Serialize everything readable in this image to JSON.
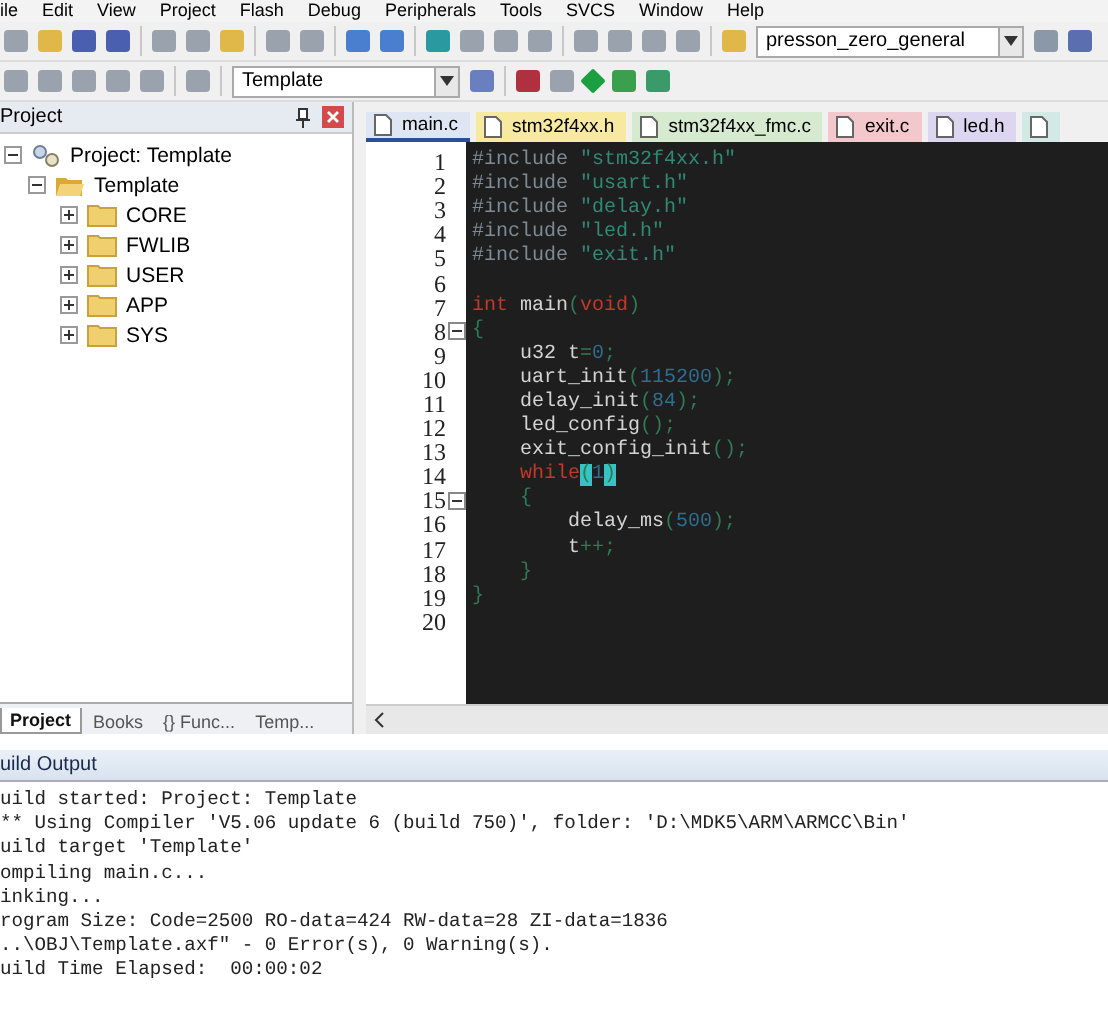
{
  "menu": [
    "ile",
    "Edit",
    "View",
    "Project",
    "Flash",
    "Debug",
    "Peripherals",
    "Tools",
    "SVCS",
    "Window",
    "Help"
  ],
  "toolbar": {
    "target_dropdown": "presson_zero_general",
    "project_dropdown": "Template"
  },
  "project_panel": {
    "title": "Project",
    "tree": [
      {
        "label": "Project: Template",
        "kind": "project",
        "expanded": true,
        "children": [
          {
            "label": "Template",
            "kind": "group",
            "expanded": true,
            "children": [
              {
                "label": "CORE",
                "kind": "folder",
                "expanded": false
              },
              {
                "label": "FWLIB",
                "kind": "folder",
                "expanded": false
              },
              {
                "label": "USER",
                "kind": "folder",
                "expanded": false
              },
              {
                "label": "APP",
                "kind": "folder",
                "expanded": false
              },
              {
                "label": "SYS",
                "kind": "folder",
                "expanded": false
              }
            ]
          }
        ]
      }
    ],
    "tabs": [
      {
        "label": "Project",
        "selected": true
      },
      {
        "label": "Books",
        "selected": false
      },
      {
        "label": "{} Func...",
        "selected": false
      },
      {
        "label": "Temp...",
        "selected": false
      }
    ]
  },
  "editor": {
    "tabs": [
      {
        "label": "main.c",
        "selected": true,
        "color": "#dfe6f3"
      },
      {
        "label": "stm32f4xx.h",
        "selected": false,
        "color": "#f7e9a0"
      },
      {
        "label": "stm32f4xx_fmc.c",
        "selected": false,
        "color": "#d6ead0"
      },
      {
        "label": "exit.c",
        "selected": false,
        "color": "#f3c8cc"
      },
      {
        "label": "led.h",
        "selected": false,
        "color": "#dcd6f0"
      },
      {
        "selected": false,
        "color": "#d3e9e6"
      }
    ],
    "lines": [
      {
        "n": "1",
        "fold": false,
        "segs": [
          {
            "t": "#include ",
            "kind": "pp"
          },
          {
            "t": "\"stm32f4xx.h\"",
            "kind": "str"
          }
        ]
      },
      {
        "n": "2",
        "fold": false,
        "segs": [
          {
            "t": "#include ",
            "kind": "pp"
          },
          {
            "t": "\"usart.h\"",
            "kind": "str"
          }
        ]
      },
      {
        "n": "3",
        "fold": false,
        "segs": [
          {
            "t": "#include ",
            "kind": "pp"
          },
          {
            "t": "\"delay.h\"",
            "kind": "str"
          }
        ]
      },
      {
        "n": "4",
        "fold": false,
        "segs": [
          {
            "t": "#include ",
            "kind": "pp"
          },
          {
            "t": "\"led.h\"",
            "kind": "str"
          }
        ]
      },
      {
        "n": "5",
        "fold": false,
        "segs": [
          {
            "t": "#include ",
            "kind": "pp"
          },
          {
            "t": "\"exit.h\"",
            "kind": "str"
          }
        ]
      },
      {
        "n": "6",
        "fold": false
      },
      {
        "n": "7",
        "fold": false,
        "segs": [
          {
            "t": "int",
            "kind": "kw"
          },
          {
            "t": " main",
            "kind": "id"
          },
          {
            "t": "(",
            "kind": "p"
          },
          {
            "t": "void",
            "kind": "kw"
          },
          {
            "t": ")",
            "kind": "p"
          }
        ]
      },
      {
        "n": "8",
        "fold": true,
        "segs": [
          {
            "t": "{",
            "kind": "p"
          }
        ]
      },
      {
        "n": "9",
        "fold": false,
        "segs": [
          {
            "t": "    u32 t",
            "kind": "id"
          },
          {
            "t": "=",
            "kind": "p"
          },
          {
            "t": "0",
            "kind": "num"
          },
          {
            "t": ";",
            "kind": "p"
          }
        ]
      },
      {
        "n": "10",
        "fold": false,
        "segs": [
          {
            "t": "    uart_init",
            "kind": "id"
          },
          {
            "t": "(",
            "kind": "p"
          },
          {
            "t": "115200",
            "kind": "num"
          },
          {
            "t": ");",
            "kind": "p"
          }
        ]
      },
      {
        "n": "11",
        "fold": false,
        "segs": [
          {
            "t": "    delay_init",
            "kind": "id"
          },
          {
            "t": "(",
            "kind": "p"
          },
          {
            "t": "84",
            "kind": "num"
          },
          {
            "t": ");",
            "kind": "p"
          }
        ]
      },
      {
        "n": "12",
        "fold": false,
        "segs": [
          {
            "t": "    led_config",
            "kind": "id"
          },
          {
            "t": "();",
            "kind": "p"
          }
        ]
      },
      {
        "n": "13",
        "fold": false,
        "segs": [
          {
            "t": "    exit_config_init",
            "kind": "id"
          },
          {
            "t": "();",
            "kind": "p"
          }
        ]
      },
      {
        "n": "14",
        "fold": false,
        "segs": [
          {
            "t": "    while",
            "kind": "kw"
          },
          {
            "t": "(",
            "kind": "match"
          },
          {
            "t": "1",
            "kind": "num"
          },
          {
            "t": ")",
            "kind": "match"
          }
        ]
      },
      {
        "n": "15",
        "fold": true,
        "segs": [
          {
            "t": "    {",
            "kind": "p"
          }
        ]
      },
      {
        "n": "16",
        "fold": false,
        "segs": [
          {
            "t": "        delay_ms",
            "kind": "id"
          },
          {
            "t": "(",
            "kind": "p"
          },
          {
            "t": "500",
            "kind": "num"
          },
          {
            "t": ");",
            "kind": "p"
          }
        ]
      },
      {
        "n": "17",
        "fold": false,
        "segs": [
          {
            "t": "        t",
            "kind": "id"
          },
          {
            "t": "++;",
            "kind": "p"
          }
        ]
      },
      {
        "n": "18",
        "fold": false,
        "segs": [
          {
            "t": "    }",
            "kind": "p"
          }
        ]
      },
      {
        "n": "19",
        "fold": false,
        "segs": [
          {
            "t": "}",
            "kind": "p"
          }
        ]
      },
      {
        "n": "20",
        "fold": false
      }
    ]
  },
  "build_output": {
    "title": "uild Output",
    "lines": [
      "uild started: Project: Template",
      "** Using Compiler 'V5.06 update 6 (build 750)', folder: 'D:\\MDK5\\ARM\\ARMCC\\Bin'",
      "uild target 'Template'",
      "ompiling main.c...",
      "inking...",
      "rogram Size: Code=2500 RO-data=424 RW-data=28 ZI-data=1836",
      "..\\OBJ\\Template.axf\" - 0 Error(s), 0 Warning(s).",
      "uild Time Elapsed:  00:00:02"
    ]
  }
}
